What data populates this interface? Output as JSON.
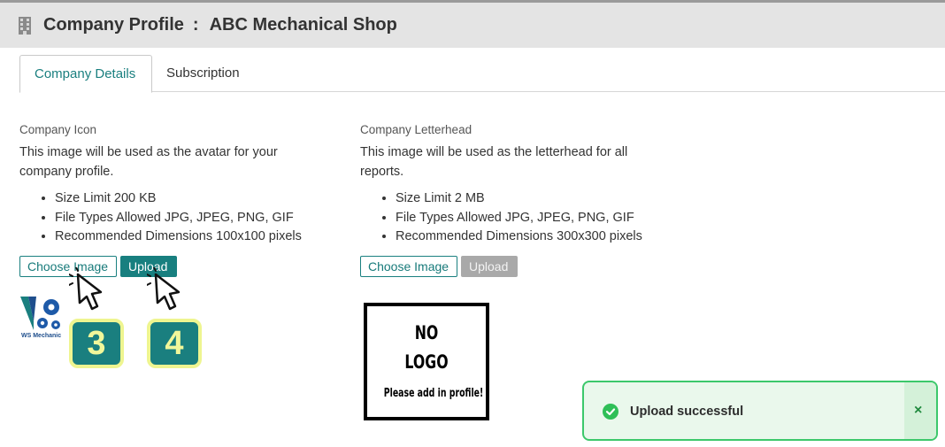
{
  "header": {
    "title": "Company Profile",
    "separator": ":",
    "company_name": "ABC Mechanical Shop"
  },
  "tabs": [
    {
      "label": "Company Details",
      "active": true
    },
    {
      "label": "Subscription",
      "active": false
    }
  ],
  "icon_section": {
    "label": "Company Icon",
    "description": "This image will be used as the avatar for your company profile.",
    "requirements": [
      "Size Limit 200 KB",
      "File Types Allowed JPG, JPEG, PNG, GIF",
      "Recommended Dimensions 100x100 pixels"
    ],
    "choose_label": "Choose Image",
    "upload_label": "Upload",
    "logo_text": "WS Mechanic"
  },
  "letterhead_section": {
    "label": "Company Letterhead",
    "description": "This image will be used as the letterhead for all reports.",
    "requirements": [
      "Size Limit 2 MB",
      "File Types Allowed JPG, JPEG, PNG, GIF",
      "Recommended Dimensions 300x300 pixels"
    ],
    "choose_label": "Choose Image",
    "upload_label": "Upload",
    "placeholder": {
      "line1": "NO",
      "line2": "LOGO",
      "line3": "Please add in profile!"
    }
  },
  "steps": [
    "3",
    "4"
  ],
  "toast": {
    "message": "Upload successful",
    "close": "×"
  },
  "colors": {
    "accent": "#187f7f",
    "success_border": "#3cc86b",
    "badge_highlight": "#eef590"
  }
}
